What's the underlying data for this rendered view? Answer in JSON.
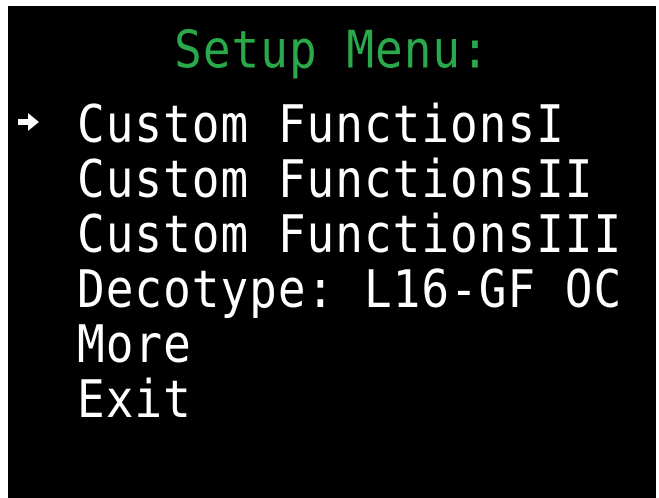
{
  "colors": {
    "background": "#000000",
    "title": "#2aa84a",
    "text": "#ffffff"
  },
  "title": "Setup Menu:",
  "selected_index": 0,
  "cursor_icon": "right-arrow-icon",
  "menu": {
    "items": [
      {
        "label": "Custom FunctionsI"
      },
      {
        "label": "Custom FunctionsII"
      },
      {
        "label": "Custom FunctionsIII"
      },
      {
        "label": "Decotype: L16-GF OC"
      },
      {
        "label": "More"
      },
      {
        "label": "Exit"
      }
    ]
  }
}
